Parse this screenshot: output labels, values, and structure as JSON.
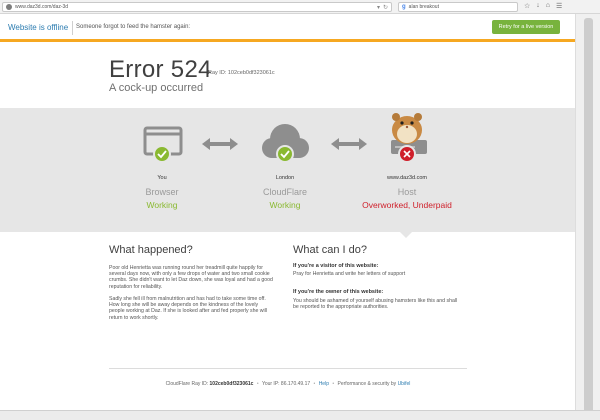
{
  "browser": {
    "url": "www.daz3d.com/daz-3d",
    "search_text": "alan breakout"
  },
  "banner": {
    "title": "Website is offline",
    "message": "Someone forgot to feed the hamster again:",
    "retry_label": "Retry for a live version"
  },
  "error": {
    "code_title": "Error 524",
    "ray_id": "Ray ID: 102ceb0df323061c",
    "subtitle": "A cock-up occurred"
  },
  "nodes": [
    {
      "label": "You",
      "name": "Browser",
      "status": "Working"
    },
    {
      "label": "London",
      "name": "CloudFlare",
      "status": "Working"
    },
    {
      "label": "www.daz3d.com",
      "name": "Host",
      "status": "Overworked, Underpaid"
    }
  ],
  "what_happened": {
    "title": "What happened?",
    "para1": "Poor old Henrietta was running round her treadmill quite happily for several days now, with only a few drops of water and two small cookie crumbs.  She didn't want to let Daz down, she was loyal and had a good reputation for reliability.",
    "para2": "Sadly she fell ill from malnutrition and has had to take some time off. How long she will be away depends on the kindness of the lovely people working at Daz.  If she is looked after and fed properly she will return to work shortly."
  },
  "what_can_i_do": {
    "title": "What can I do?",
    "visitor_head": "If you're a visitor of this website:",
    "visitor_text": "Pray for Henrietta and write her letters of support",
    "owner_head": "If you're the owner of this website:",
    "owner_text": "You should be ashamed of yourself abusing hamsters like this and shall be reported to the appropriate authorities."
  },
  "footer": {
    "ray_label": "CloudFlare Ray ID:",
    "ray_value": "102ceb0df323061c",
    "ip_label": "Your IP: 86.170.49.17",
    "help_label": "Help",
    "perf_label": "Performance & security by",
    "brand_label": "Ubifel"
  },
  "colors": {
    "ok_green": "#8ab931",
    "error_red": "#cf1f2a",
    "accent_orange": "#f6a821",
    "link_blue": "#2c7cb0",
    "retry_green": "#78b33d"
  },
  "icons": [
    "globe-icon",
    "reload-icon",
    "star-icon",
    "home-icon",
    "browser-window-icon",
    "cloud-icon",
    "server-icon",
    "check-icon",
    "x-icon",
    "double-arrow-icon",
    "hamster-image"
  ]
}
